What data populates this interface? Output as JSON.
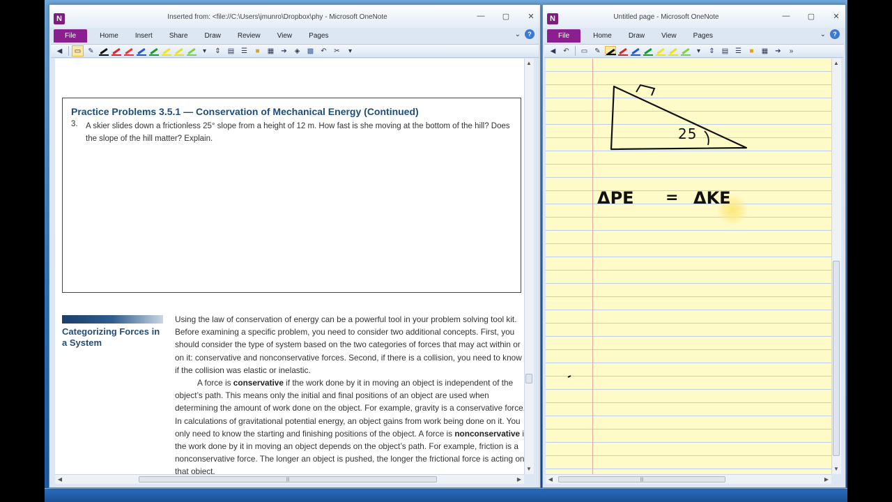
{
  "colors": {
    "file_tab": "#8b1f8f",
    "heading_blue": "#1f4d7a",
    "note_paper": "#fffbc8",
    "rule_line": "#b9cde6"
  },
  "left_window": {
    "app_icon": "N",
    "title": "Inserted from: <file://C:\\Users\\jmunro\\Dropbox\\phy  -  Microsoft OneNote",
    "controls": {
      "minimize": "—",
      "maximize": "▢",
      "close": "✕"
    },
    "tabs": {
      "file": "File",
      "home": "Home",
      "insert": "Insert",
      "share": "Share",
      "draw": "Draw",
      "review": "Review",
      "view": "View",
      "pages": "Pages"
    },
    "help_chevron": "⌄",
    "help_icon": "?",
    "toolbar_icons": [
      "back-arrow-icon",
      "select-icon",
      "lasso-icon",
      "eraser-icon",
      "black-pen-icon",
      "red-pen-icon",
      "blue-pen-icon",
      "green-pen-icon",
      "yellow-highlighter-icon",
      "yellow-highlighter-icon",
      "green-highlighter-icon",
      "more-pens-icon",
      "insert-space-icon",
      "note-icon",
      "outline-icon",
      "table-icon",
      "arrow-icon",
      "tag-icon",
      "grid-icon",
      "undo-icon",
      "tools-icon",
      "customize-icon"
    ],
    "document": {
      "practice_title": "Practice Problems 3.5.1 — Conservation of Mechanical Energy (Continued)",
      "problem_number": "3.",
      "problem_text": "A skier slides down a frictionless 25° slope from a height of 12 m. How fast is she moving at the bottom of the hill? Does the slope of the hill matter? Explain.",
      "sidebar_title": "Categorizing Forces in a System",
      "paragraph1": "Using the law of conservation of energy can be a powerful tool in your problem solving tool kit. Before examining a specific problem, you need to consider two additional concepts. First, you should consider the type of system based on the two categories of forces that may act within or on it: conservative and nonconservative forces. Second, if there is a collision, you need to know if the collision was elastic or inelastic.",
      "p2_a": "A force is ",
      "p2_bold1": "conservative",
      "p2_b": " if the work done by it in moving an object is independent of the object’s path. This means only the initial and final positions of an object are used when determining the amount of work done on the object. For example, gravity is a conservative force. In calculations of gravitational potential energy, an object gains from work being done on it. You only need to know the starting and finishing positions of the object. A force is ",
      "p2_bold2": "nonconservative",
      "p2_c": " if the work done by it in moving an object depends on the object’s path. For example, friction is a nonconservative force. The longer an object is pushed, the longer the frictional force is acting on that object."
    }
  },
  "right_window": {
    "app_icon": "N",
    "title": "Untitled page  -  Microsoft OneNote",
    "controls": {
      "minimize": "—",
      "maximize": "▢",
      "close": "✕"
    },
    "tabs": {
      "file": "File",
      "home": "Home",
      "draw": "Draw",
      "view": "View",
      "pages": "Pages"
    },
    "help_chevron": "⌄",
    "help_icon": "?",
    "note": {
      "triangle_angle": "25",
      "equation_left": "ΔPE",
      "equation_equals": "=",
      "equation_right": "ΔKE"
    }
  },
  "scroll": {
    "up": "▲",
    "down": "▼",
    "left": "◀",
    "right": "▶",
    "grip": "|||"
  }
}
